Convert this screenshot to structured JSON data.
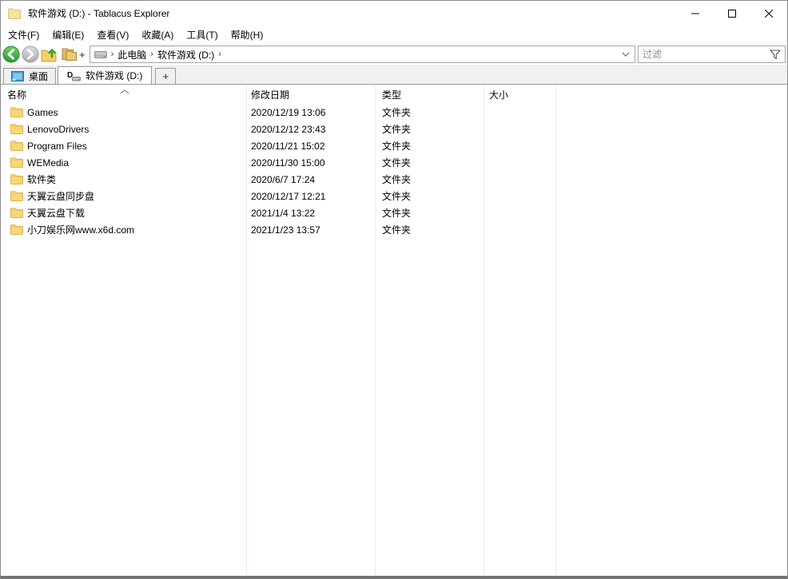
{
  "window": {
    "title": "软件游戏 (D:) - Tablacus Explorer",
    "controls": [
      {
        "name": "minimize"
      },
      {
        "name": "maximize"
      },
      {
        "name": "close"
      }
    ]
  },
  "menubar": {
    "items": [
      {
        "label": "文件(F)"
      },
      {
        "label": "编辑(E)"
      },
      {
        "label": "查看(V)"
      },
      {
        "label": "收藏(A)"
      },
      {
        "label": "工具(T)"
      },
      {
        "label": "帮助(H)"
      }
    ]
  },
  "toolbar": {
    "new_tab_plus": "+",
    "address": {
      "separator": "›",
      "segments": [
        "此电脑",
        "软件游戏 (D:)"
      ]
    },
    "filter_placeholder": "过滤"
  },
  "tabbar": {
    "tabs": [
      {
        "label": "桌面",
        "icon": "desktop-icon",
        "active": false
      },
      {
        "label": "软件游戏 (D:)",
        "icon": "drive-d-icon",
        "active": true
      }
    ],
    "new_tab_label": "+"
  },
  "list": {
    "columns": [
      "名称",
      "修改日期",
      "类型",
      "大小"
    ],
    "sort_column": "名称",
    "sort_direction": "ascending",
    "rows": [
      {
        "name": "Games",
        "modified": "2020/12/19 13:06",
        "type": "文件夹",
        "size": ""
      },
      {
        "name": "LenovoDrivers",
        "modified": "2020/12/12 23:43",
        "type": "文件夹",
        "size": ""
      },
      {
        "name": "Program Files",
        "modified": "2020/11/21 15:02",
        "type": "文件夹",
        "size": ""
      },
      {
        "name": "WEMedia",
        "modified": "2020/11/30 15:00",
        "type": "文件夹",
        "size": ""
      },
      {
        "name": "软件类",
        "modified": "2020/6/7 17:24",
        "type": "文件夹",
        "size": ""
      },
      {
        "name": "天翼云盘同步盘",
        "modified": "2020/12/17 12:21",
        "type": "文件夹",
        "size": ""
      },
      {
        "name": "天翼云盘下载",
        "modified": "2021/1/4 13:22",
        "type": "文件夹",
        "size": ""
      },
      {
        "name": "小刀娱乐网www.x6d.com",
        "modified": "2021/1/23 13:57",
        "type": "文件夹",
        "size": ""
      }
    ]
  },
  "colors": {
    "folder": "#F8D775",
    "back_button": "#3CB44A",
    "tab_bar_bg": "#F0F0F0",
    "column_separator": "#E6EEFA"
  }
}
